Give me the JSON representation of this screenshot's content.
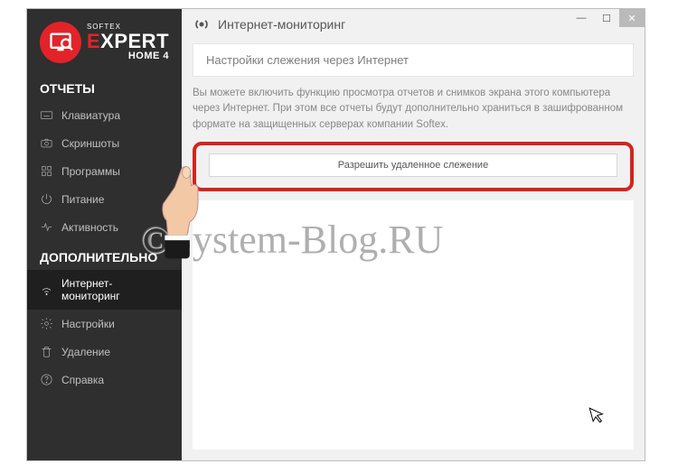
{
  "brand": {
    "softex": "SOFTEX",
    "expert_e": "E",
    "expert_rest": "XPERT",
    "home": "HOME 4"
  },
  "sidebar": {
    "section_reports": "ОТЧЕТЫ",
    "section_additional": "ДОПОЛНИТЕЛЬНО",
    "items_reports": [
      {
        "label": "Клавиатура"
      },
      {
        "label": "Скриншоты"
      },
      {
        "label": "Программы"
      },
      {
        "label": "Питание"
      },
      {
        "label": "Активность"
      }
    ],
    "items_additional": [
      {
        "label": "Интернет-мониторинг"
      },
      {
        "label": "Настройки"
      },
      {
        "label": "Удаление"
      },
      {
        "label": "Справка"
      }
    ]
  },
  "main": {
    "title": "Интернет-мониторинг",
    "subheader": "Настройки слежения через Интернет",
    "description": "Вы можете включить функцию просмотра отчетов и снимков экрана этого компьютера через Интернет. При этом все отчеты будут дополнительно храниться в зашифрованном формате на защищенных серверах компании Softex.",
    "allow_button": "Разрешить удаленное слежение"
  },
  "window_controls": {
    "minimize": "—",
    "maximize": "☐",
    "close": "✕"
  },
  "watermark": "©System-Blog.RU"
}
